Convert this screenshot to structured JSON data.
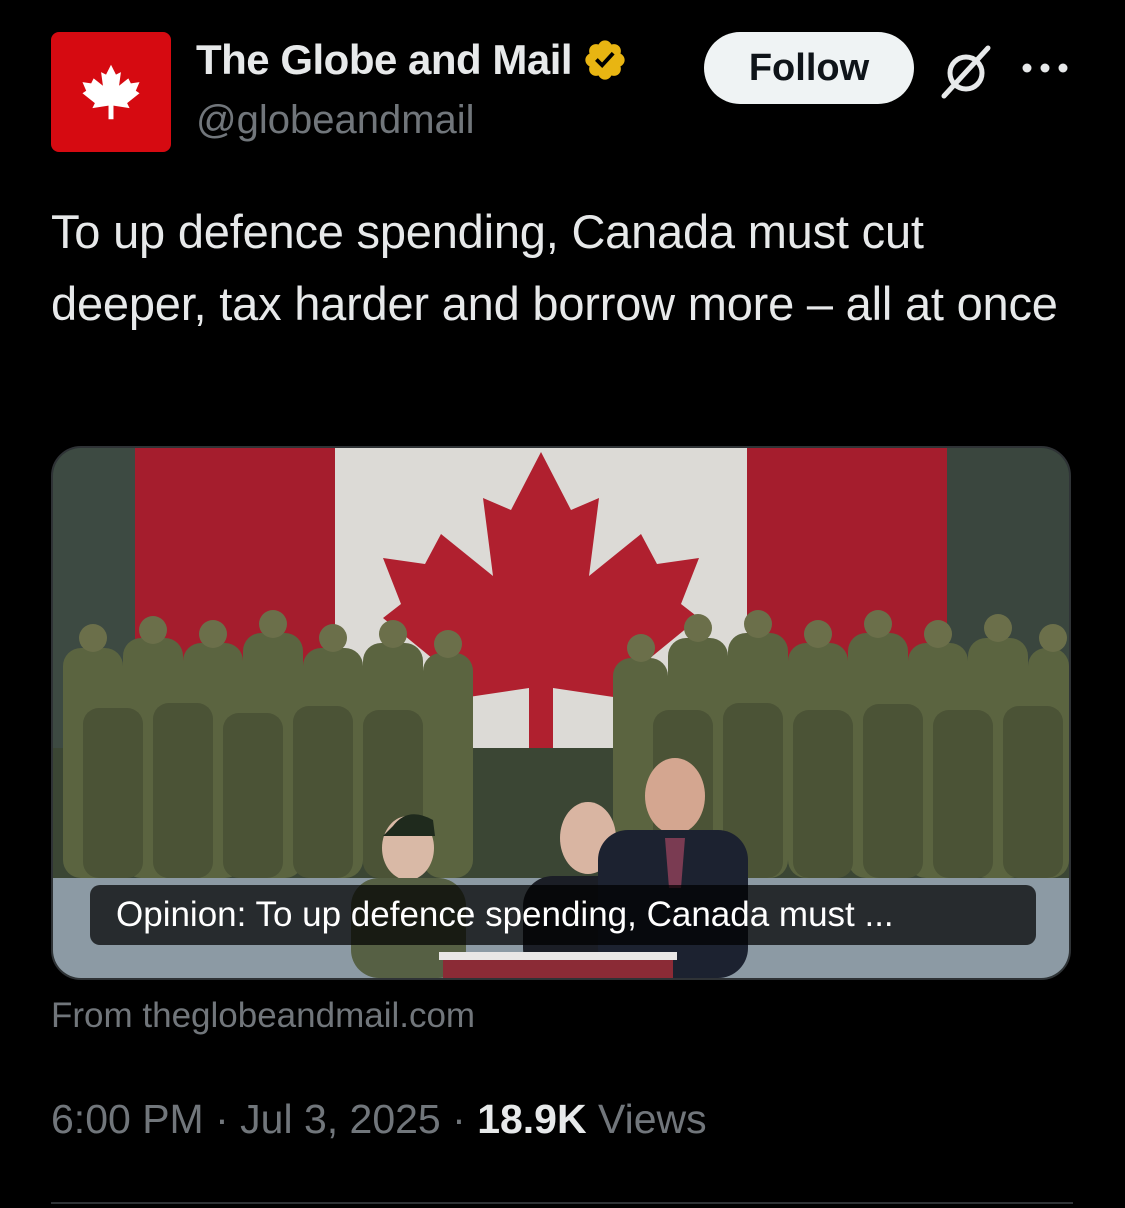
{
  "account": {
    "display_name": "The Globe and Mail",
    "handle": "@globeandmail",
    "avatar_icon": "maple-leaf-icon",
    "avatar_color": "#d60a11",
    "verified_badge": "verified-gold-badge-icon",
    "verified_color": "#e8b512"
  },
  "actions": {
    "follow_label": "Follow",
    "grok_icon": "grok-icon",
    "more_icon": "more-options-icon"
  },
  "tweet": {
    "text": "To up defence spending, Canada must cut deeper, tax harder and borrow more – all at once"
  },
  "link_card": {
    "image_description_icon": "article-thumbnail",
    "caption": "Opinion: To up defence spending, Canada must ...",
    "source": "From theglobeandmail.com"
  },
  "meta": {
    "time": "6:00 PM",
    "separator": " · ",
    "date": "Jul 3, 2025",
    "views_count": "18.9K",
    "views_label": "Views"
  },
  "colors": {
    "background": "#000000",
    "primary_text": "#e7e9ea",
    "secondary_text": "#71767b",
    "border": "#2f3336",
    "follow_bg": "#eff3f4"
  }
}
